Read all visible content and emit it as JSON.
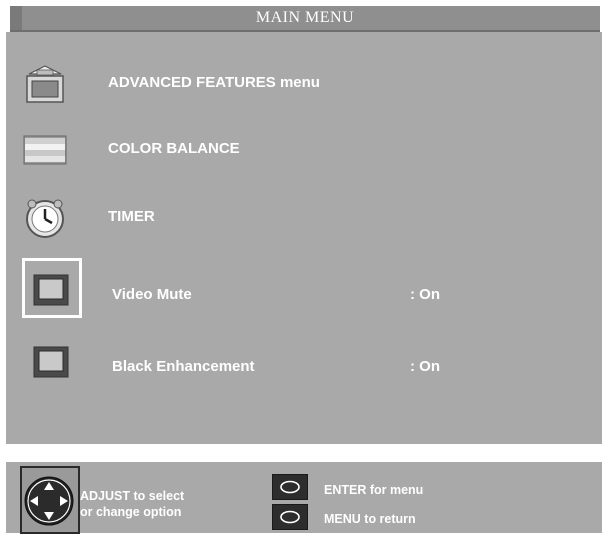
{
  "title": "MAIN MENU",
  "menu": {
    "items": [
      {
        "label": "ADVANCED FEATURES menu",
        "icon": "advanced-features-icon",
        "value": ""
      },
      {
        "label": "COLOR BALANCE",
        "icon": "color-balance-icon",
        "value": ""
      },
      {
        "label": "TIMER",
        "icon": "timer-clock-icon",
        "value": ""
      },
      {
        "label": "Video Mute",
        "icon": "video-mute-icon",
        "value": ":  On",
        "selected": true
      },
      {
        "label": "Black Enhancement",
        "icon": "black-enhancement-icon",
        "value": ":  On"
      }
    ]
  },
  "help": {
    "adjust_line1": "ADJUST to select",
    "adjust_line2": "or  change option",
    "enter_text": "ENTER for menu",
    "menu_text": "MENU  to  return"
  },
  "colors": {
    "panel": "#a9a9a9",
    "title_bar": "#8f8f8f",
    "text": "#ffffff",
    "selection_border": "#ffffff"
  }
}
